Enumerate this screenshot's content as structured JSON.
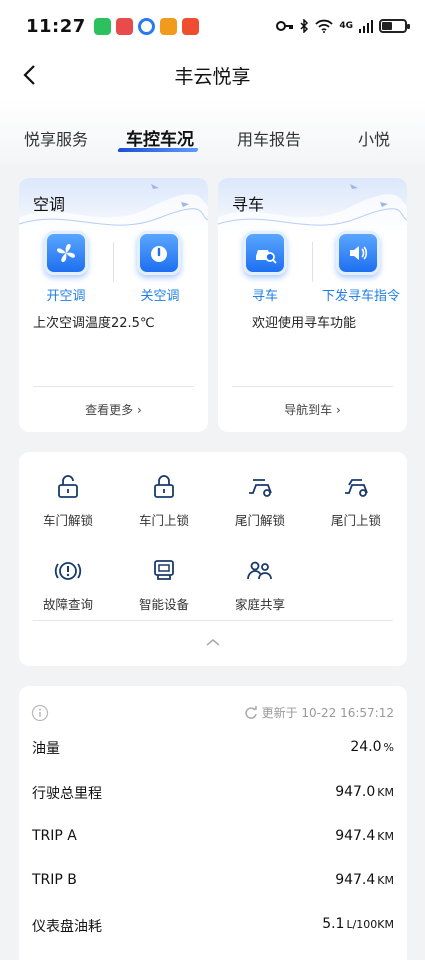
{
  "status_bar": {
    "time": "11:27",
    "app_badges": [
      {
        "icon": "wechat-icon",
        "color": "#2dc15e"
      },
      {
        "icon": "app-red-icon",
        "color": "#e74b4b"
      },
      {
        "icon": "app-blue-icon",
        "color": "#2a79f0"
      },
      {
        "icon": "app-orange-icon",
        "color": "#f09b1e"
      },
      {
        "icon": "taobao-icon",
        "color": "#ef4d2f"
      }
    ],
    "network": "4G",
    "wifi_badge": "6"
  },
  "header": {
    "title": "丰云悦享"
  },
  "tabs": [
    {
      "label": "悦享服务",
      "active": false
    },
    {
      "label": "车控车况",
      "active": true
    },
    {
      "label": "用车报告",
      "active": false
    },
    {
      "label": "小悦",
      "active": false
    }
  ],
  "ac_card": {
    "title": "空调",
    "buttons": [
      {
        "label": "开空调",
        "icon": "fan-icon"
      },
      {
        "label": "关空调",
        "icon": "power-icon"
      }
    ],
    "info": "上次空调温度22.5℃",
    "more": "查看更多"
  },
  "find_card": {
    "title": "寻车",
    "buttons": [
      {
        "label": "寻车",
        "icon": "car-search-icon"
      },
      {
        "label": "下发寻车指令",
        "icon": "speaker-icon"
      }
    ],
    "info": "欢迎使用寻车功能",
    "more": "导航到车"
  },
  "controls": [
    {
      "label": "车门解锁",
      "icon": "unlock-icon"
    },
    {
      "label": "车门上锁",
      "icon": "lock-icon"
    },
    {
      "label": "尾门解锁",
      "icon": "trunk-unlock-icon"
    },
    {
      "label": "尾门上锁",
      "icon": "trunk-lock-icon"
    },
    {
      "label": "故障查询",
      "icon": "fault-icon"
    },
    {
      "label": "智能设备",
      "icon": "device-icon"
    },
    {
      "label": "家庭共享",
      "icon": "family-icon"
    }
  ],
  "vehicle_status": {
    "updated": "更新于 10-22 16:57:12",
    "rows": [
      {
        "label": "油量",
        "value": "24.0",
        "unit": "%"
      },
      {
        "label": "行驶总里程",
        "value": "947.0",
        "unit": "KM"
      },
      {
        "label": "TRIP A",
        "value": "947.4",
        "unit": "KM"
      },
      {
        "label": "TRIP B",
        "value": "947.4",
        "unit": "KM"
      },
      {
        "label": "仪表盘油耗",
        "value": "5.1",
        "unit": "L/100KM"
      }
    ]
  },
  "colors": {
    "accent": "#1f7fe6",
    "icon_dark": "#1a3a6e",
    "tab_underline": "#1b4fd4"
  }
}
